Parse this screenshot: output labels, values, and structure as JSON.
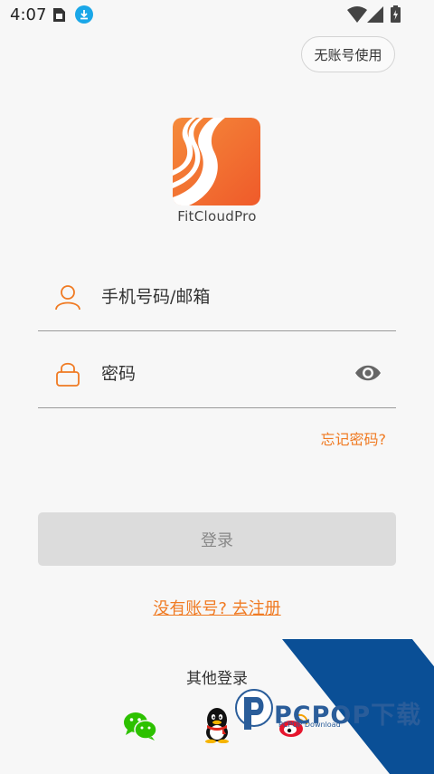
{
  "status_bar": {
    "time": "4:07",
    "download_icon": "download-icon",
    "wifi_icon": "wifi-icon",
    "signal_icon": "signal-icon",
    "battery_icon": "battery-icon"
  },
  "header": {
    "guest_button_label": "无账号使用"
  },
  "app": {
    "name": "FitCloudPro",
    "logo_icon": "fitcloudpro-logo"
  },
  "form": {
    "phone_placeholder": "手机号码/邮箱",
    "phone_value": "",
    "password_placeholder": "密码",
    "password_value": "",
    "forgot_label": "忘记密码?"
  },
  "actions": {
    "login_label": "登录",
    "register_label": "没有账号? 去注册"
  },
  "other_login": {
    "title": "其他登录",
    "providers": [
      "wechat-icon",
      "qq-icon",
      "weibo-icon"
    ]
  },
  "watermark": {
    "brand": "PCPOP下载",
    "subtitle": "PCPOP Download"
  },
  "colors": {
    "accent": "#f07a22",
    "background": "#f7f7f7",
    "button_disabled": "#dcdcdc",
    "watermark_blue": "#0a4f96"
  }
}
